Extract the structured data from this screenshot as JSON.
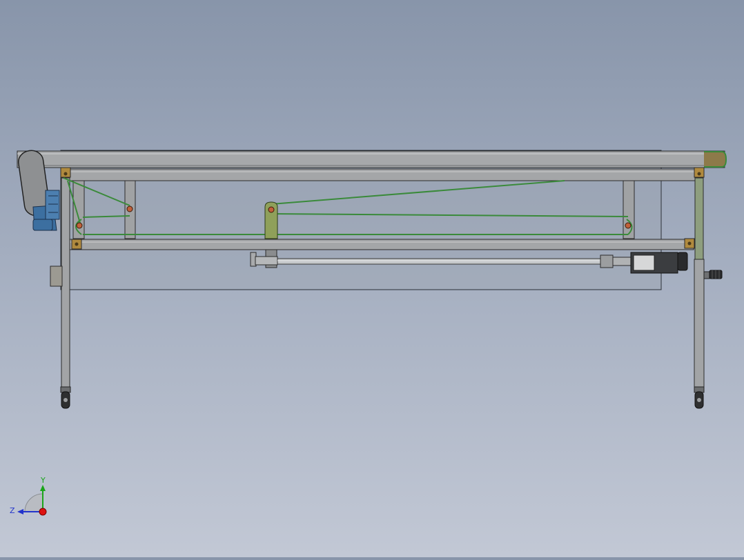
{
  "viewport": {
    "background_top": "#8895aa",
    "background_bottom": "#c2c8d5"
  },
  "model": {
    "motor_label": "MOTOR",
    "motor_color": "#3c6fa0",
    "belt_color": "#3a8a3a",
    "bracket_color": "#b08a3e",
    "frame_color": "#9fa1a3",
    "cylinder_color": "#c5c8cb"
  },
  "triad": {
    "y_label": "Y",
    "z_label": "Z",
    "y_color": "#1aa51a",
    "z_color": "#2233cc",
    "x_color": "#dd1111"
  }
}
